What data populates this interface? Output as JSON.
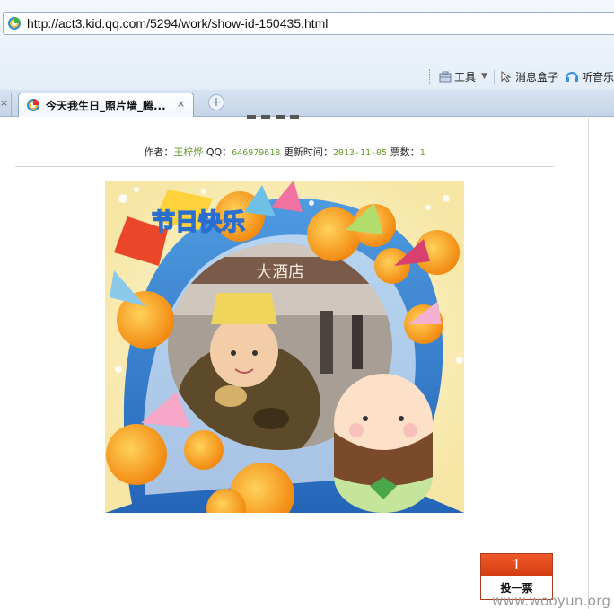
{
  "browser": {
    "url": "http://act3.kid.qq.com/5294/work/show-id-150435.html",
    "toolbar": {
      "tools_label": "工具",
      "msgbox_label": "消息盒子",
      "music_label": "听音乐"
    },
    "tabs": [
      {
        "title": "今天我生日_照片墙_腾...",
        "active": true
      }
    ],
    "close_glyph": "×",
    "new_tab_glyph": "+"
  },
  "work": {
    "author_label": "作者：",
    "author": "王梓烨",
    "qq_label": "QQ：",
    "qq": "646979618",
    "updated_label": "更新时间：",
    "updated": "2013-11-05",
    "votes_label": "票数：",
    "votes": "1",
    "photo": {
      "frame_text": "节日快乐",
      "sign_text": "大酒店"
    }
  },
  "vote_button": {
    "count": "1",
    "label": "投一票"
  },
  "watermark": "www.wooyun.org",
  "colors": {
    "accent_green": "#6a9a32",
    "vote_red": "#e04a1c",
    "chrome_blue": "#dbe6f3"
  }
}
